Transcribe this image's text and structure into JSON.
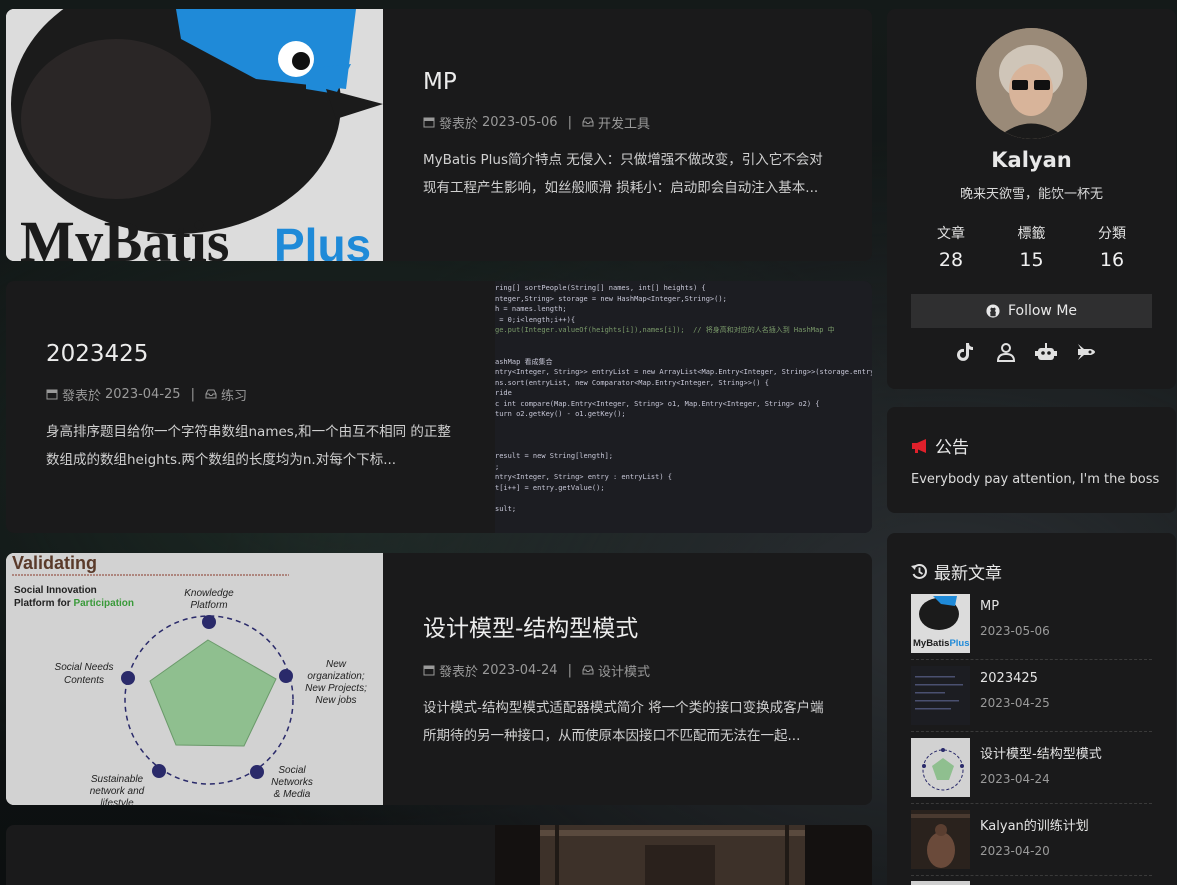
{
  "posts": [
    {
      "title": "MP",
      "meta_prefix": "發表於",
      "date": "2023-05-06",
      "category": "开发工具",
      "excerpt": "MyBatis Plus简介特点 无侵入：只做增强不做改变，引入它不会对现有工程产生影响，如丝般顺滑 损耗小：启动即会自动注入基本...",
      "logo_text": "MyBatis",
      "logo_accent": "Plus"
    },
    {
      "title": "2023425",
      "meta_prefix": "發表於",
      "date": "2023-04-25",
      "category": "练习",
      "excerpt": "身高排序题目给你一个字符串数组names,和一个由互不相同 的正整数组成的数组heights.两个数组的长度均为n.对每个下标...",
      "code_lines": [
        "ring[] sortPeople(String[] names, int[] heights) {",
        "nteger,String> storage = new HashMap<Integer,String>();",
        "h = names.length;",
        " = 0;i<length;i++){",
        "ge.put(Integer.valueOf(heights[i]),names[i]);  // 将身高和对应的人名插入到 HashMap 中",
        "",
        "",
        "ashMap 看成集合",
        "ntry<Integer, String>> entryList = new ArrayList<Map.Entry<Integer, String>>(storage.entrySet()",
        "ns.sort(entryList, new Comparator<Map.Entry<Integer, String>>() {",
        "ride",
        "c int compare(Map.Entry<Integer, String> o1, Map.Entry<Integer, String> o2) {",
        "turn o2.getKey() - o1.getKey();",
        "",
        "",
        "",
        "result = new String[length];",
        ";",
        "ntry<Integer, String> entry : entryList) {",
        "t[i++] = entry.getValue();",
        "",
        "sult;"
      ]
    },
    {
      "title": "设计模型-结构型模式",
      "meta_prefix": "發表於",
      "date": "2023-04-24",
      "category": "设计模式",
      "excerpt": "设计模式-结构型模式适配器模式简介 将一个类的接口变换成客户端所期待的另一种接口，从而使原本因接口不匹配而无法在一起...",
      "diagram": {
        "heading": "Validating",
        "sub1": "Social Innovation",
        "sub2a": "Platform for ",
        "sub2b": "Participation",
        "labels": [
          "Knowledge Platform",
          "New organization, New Projects, New jobs",
          "Social Networks & Media",
          "Sustainable network and lifestyle",
          "Social Needs Contents"
        ]
      }
    }
  ],
  "profile": {
    "name": "Kalyan",
    "bio": "晚来天欲雪，能饮一杯无",
    "stats": [
      {
        "label": "文章",
        "value": "28"
      },
      {
        "label": "標籤",
        "value": "15"
      },
      {
        "label": "分類",
        "value": "16"
      }
    ],
    "follow_label": "Follow Me",
    "socials": [
      "tiktok-icon",
      "user-icon",
      "robot-icon",
      "rocket-icon"
    ]
  },
  "announcement": {
    "title": "公告",
    "text": "Everybody pay attention, I'm the boss"
  },
  "recent": {
    "title": "最新文章",
    "items": [
      {
        "title": "MP",
        "date": "2023-05-06"
      },
      {
        "title": "2023425",
        "date": "2023-04-25"
      },
      {
        "title": "设计模型-结构型模式",
        "date": "2023-04-24"
      },
      {
        "title": "Kalyan的训练计划",
        "date": "2023-04-20"
      }
    ]
  },
  "colors": {
    "accent_red": "#e0202b",
    "mybatis_blue": "#1f8ad8",
    "card_bg": "#1a1a1b"
  }
}
